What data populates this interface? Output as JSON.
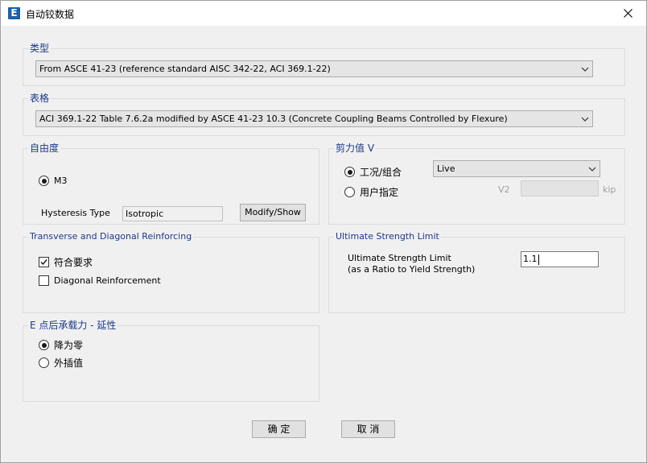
{
  "window": {
    "title": "自动铰数据",
    "app_icon_letter": "E"
  },
  "type_group": {
    "label": "类型",
    "selected": "From ASCE 41-23 (reference standard AISC 342-22, ACI 369.1-22)"
  },
  "table_group": {
    "label": "表格",
    "selected": "ACI 369.1-22 Table 7.6.2a modified by ASCE 41-23 10.3 (Concrete Coupling Beams Controlled by Flexure)"
  },
  "dof_group": {
    "label": "自由度",
    "m3_label": "M3",
    "hysteresis_label": "Hysteresis Type",
    "hysteresis_value": "Isotropic",
    "modify_button": "Modify/Show"
  },
  "shear_group": {
    "label": "剪力值 V",
    "load_case_label": "工况/组合",
    "load_case_value": "Live",
    "user_label": "用户指定",
    "v2_label": "V2",
    "unit": "kip"
  },
  "reinforcing_group": {
    "label": "Transverse and Diagonal Reinforcing",
    "conforming_label": "符合要求",
    "diagonal_label": "Diagonal Reinforcement"
  },
  "ultimate_group": {
    "label": "Ultimate Strength Limit",
    "field_label_line1": "Ultimate Strength Limit",
    "field_label_line2": "(as a Ratio to Yield Strength)",
    "value": "1.1"
  },
  "point_e_group": {
    "label": "E 点后承载力 - 延性",
    "drop_to_zero": "降为零",
    "extrapolate": "外插值"
  },
  "buttons": {
    "ok": "确 定",
    "cancel": "取 消"
  }
}
